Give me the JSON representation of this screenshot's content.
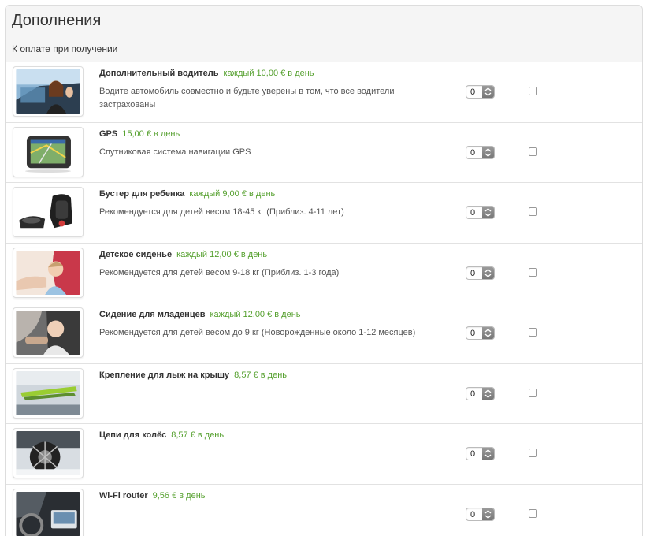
{
  "panel": {
    "title": "Дополнения",
    "subtitle": "К оплате при получении"
  },
  "colors": {
    "price": "#55a02e",
    "row_border": "#e2e2e2",
    "header_bg": "#f5f5f5"
  },
  "extras": [
    {
      "name": "Дополнительный водитель",
      "price": "каждый 10,00 € в день",
      "description": "Водите автомобиль совместно и будьте уверены в том, что все водители застрахованы",
      "quantity": "0",
      "icon": "additional-driver-photo"
    },
    {
      "name": "GPS",
      "price": "15,00 € в день",
      "description": "Спутниковая система навигации GPS",
      "quantity": "0",
      "icon": "gps-device-photo"
    },
    {
      "name": "Бустер для ребенка",
      "price": "каждый 9,00 € в день",
      "description": "Рекомендуется для детей весом 18-45 кг (Приблиз. 4-11 лет)",
      "quantity": "0",
      "icon": "booster-seat-photo"
    },
    {
      "name": "Детское сиденье",
      "price": "каждый 12,00 € в день",
      "description": "Рекомендуется для детей весом 9-18 кг (Приблиз. 1-3 года)",
      "quantity": "0",
      "icon": "child-seat-photo"
    },
    {
      "name": "Сидение для младенцев",
      "price": "каждый 12,00 € в день",
      "description": "Рекомендуется для детей весом до 9 кг (Новорожденные около 1-12 месяцев)",
      "quantity": "0",
      "icon": "infant-seat-photo"
    },
    {
      "name": "Крепление для лыж на крышу",
      "price": "8,57 € в день",
      "description": "",
      "quantity": "0",
      "icon": "ski-rack-photo"
    },
    {
      "name": "Цепи для колёс",
      "price": "8,57 € в день",
      "description": "",
      "quantity": "0",
      "icon": "snow-chains-photo"
    },
    {
      "name": "Wi-Fi router",
      "price": "9,56 € в день",
      "description": "",
      "quantity": "0",
      "icon": "wifi-router-photo"
    }
  ]
}
